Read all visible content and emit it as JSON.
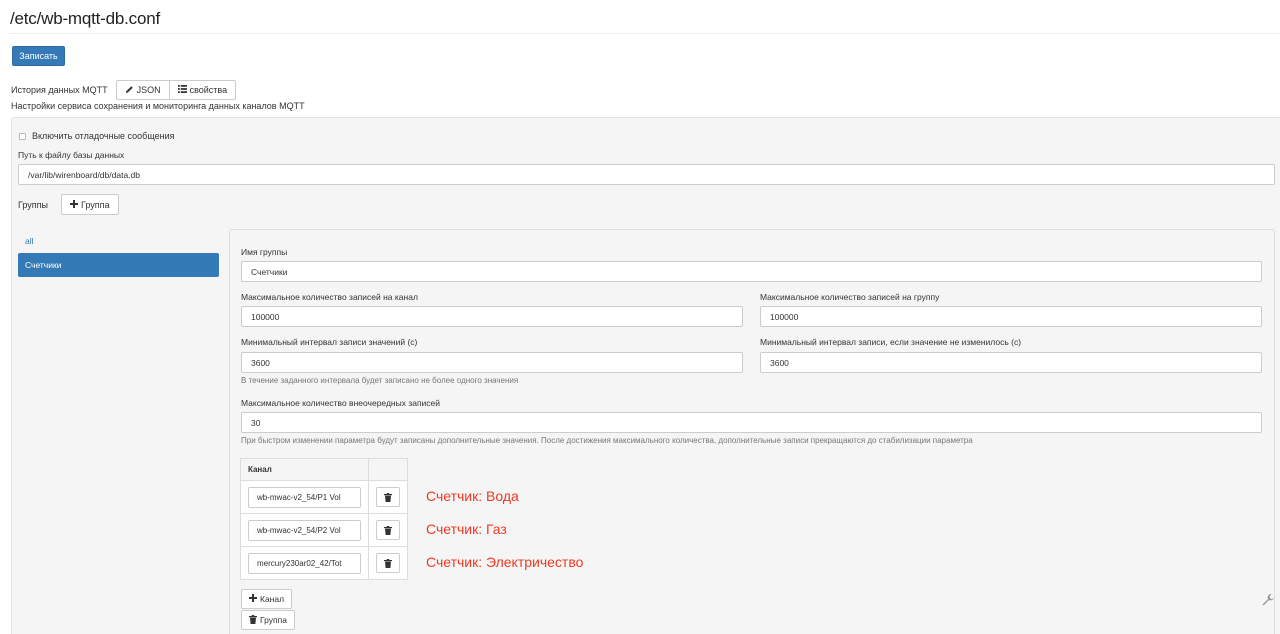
{
  "page": {
    "title": "/etc/wb-mqtt-db.conf",
    "save_label": "Записать"
  },
  "editor": {
    "label": "История данных MQTT",
    "json_button": "JSON",
    "properties_button": "свойства",
    "description": "Настройки сервиса сохранения и мониторинга данных каналов MQTT"
  },
  "settings": {
    "debug_label": "Включить отладочные сообщения",
    "debug_checked": false,
    "db_path_label": "Путь к файлу базы данных",
    "db_path_value": "/var/lib/wirenboard/db/data.db"
  },
  "groups": {
    "label": "Группы",
    "add_button": "Группа",
    "items": [
      {
        "label": "all",
        "active": false
      },
      {
        "label": "Счетчики",
        "active": true
      }
    ]
  },
  "group_form": {
    "name_label": "Имя группы",
    "name_value": "Счетчики",
    "max_records_channel_label": "Максимальное количество записей на канал",
    "max_records_channel_value": "100000",
    "max_records_group_label": "Максимальное количество записей на группу",
    "max_records_group_value": "100000",
    "min_interval_label": "Минимальный интервал записи значений (с)",
    "min_interval_value": "3600",
    "min_interval_help": "В течение заданного интервала будет записано не более одного значения",
    "min_unchanged_label": "Минимальный интервал записи, если значение не изменилось (с)",
    "min_unchanged_value": "3600",
    "max_burst_label": "Максимальное количество внеочередных записей",
    "max_burst_value": "30",
    "max_burst_help": "При быстром изменении параметра будут записаны дополнительные значения. После достижения максимального количества, дополнительные записи прекращаются до стабилизации параметра",
    "channels_header": "Канал",
    "channels": [
      "wb-mwac-v2_54/P1 Vol",
      "wb-mwac-v2_54/P2 Vol",
      "mercury230ar02_42/Tot"
    ],
    "add_channel_button": "Канал",
    "delete_group_button": "Группа"
  },
  "annotations": [
    "Счетчик: Вода",
    "Счетчик: Газ",
    "Счетчик: Электричество"
  ],
  "colors": {
    "primary": "#337ab7",
    "annotation": "#ee3a24",
    "well_bg": "#f5f5f5"
  }
}
